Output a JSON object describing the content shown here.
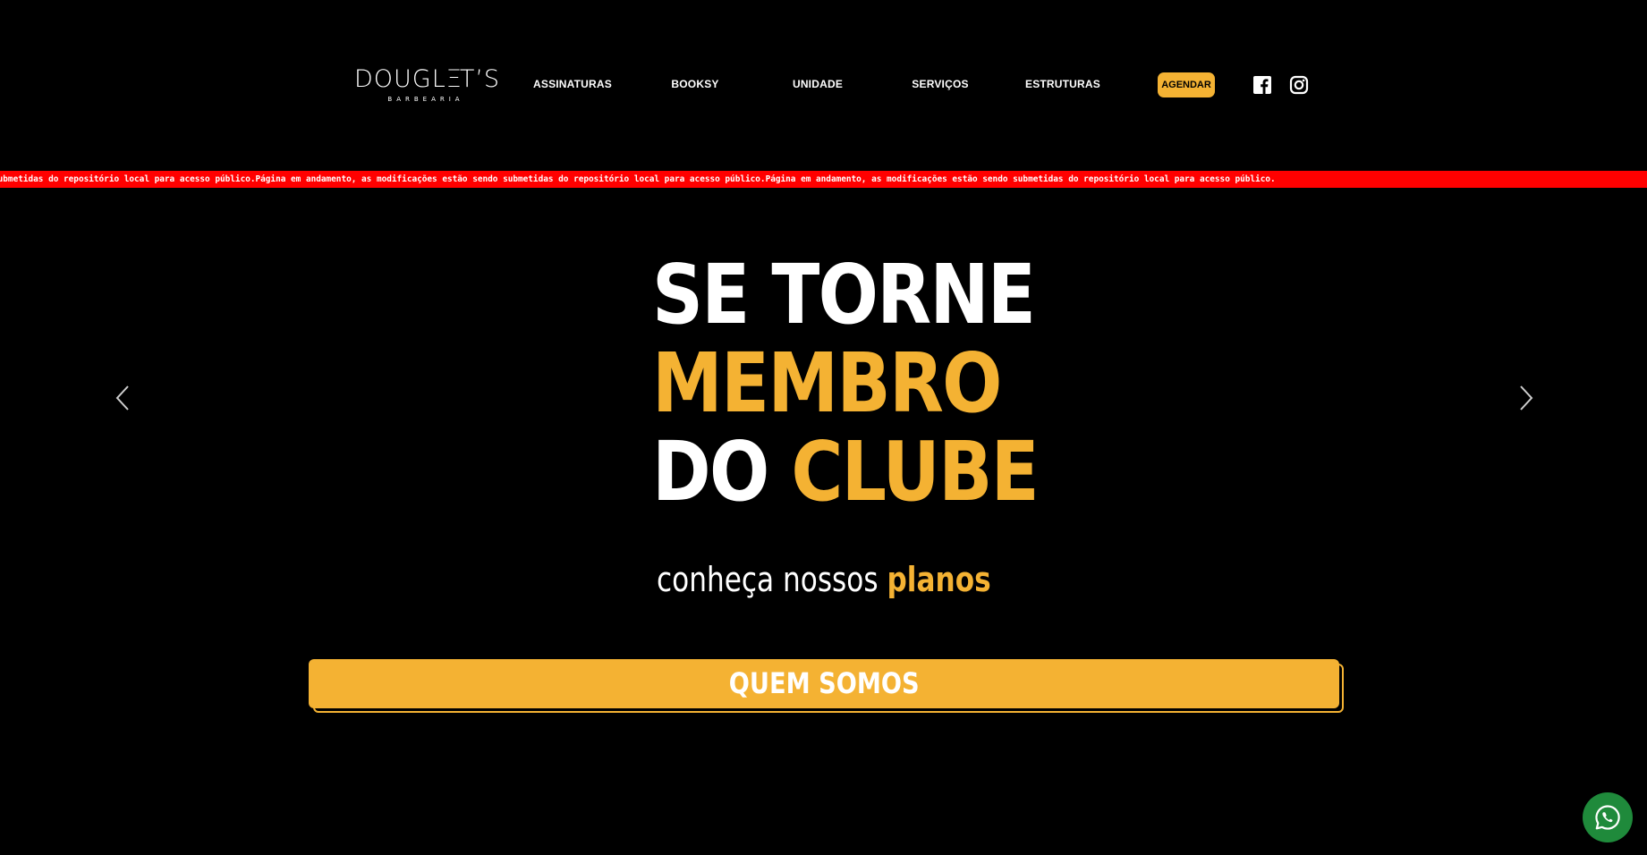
{
  "brand": {
    "logo_main": "DOUGLETS",
    "logo_sub": "BARBEARIA"
  },
  "nav": {
    "items": [
      {
        "label": "ASSINATURAS"
      },
      {
        "label": "BOOKSY"
      },
      {
        "label": "UNIDADE"
      },
      {
        "label": "SERVIÇOS"
      },
      {
        "label": "ESTRUTURAS"
      }
    ],
    "cta_label": "AGENDAR",
    "social": [
      {
        "icon": "facebook-icon"
      },
      {
        "icon": "instagram-icon"
      }
    ]
  },
  "ticker": {
    "text": "submetidas do repositório local para acesso público.Página em andamento, as modificações estão sendo submetidas do repositório local para acesso público.Página em andamento, as modificações estão sendo submetidas do repositório local para acesso público.",
    "background": "#ff0000"
  },
  "hero": {
    "line1": "SE TORNE",
    "line2": "MEMBRO",
    "line3_white": "DO",
    "line3_gold": "CLUBE",
    "subtitle_white": "conheça nossos",
    "subtitle_gold": "planos",
    "button_label": "QUEM SOMOS",
    "prev_icon": "chevron-left-icon",
    "next_icon": "chevron-right-icon"
  },
  "floating": {
    "icon": "whatsapp-icon"
  },
  "colors": {
    "background": "#000000",
    "accent": "#f4b233",
    "text": "#ffffff",
    "whatsapp": "#1f8a3b"
  }
}
